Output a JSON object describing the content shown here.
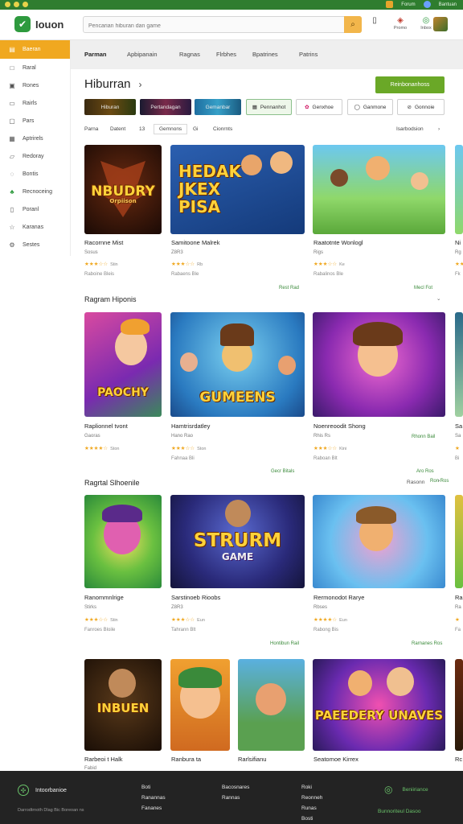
{
  "window": {
    "chrome_right": [
      "Forum",
      "Bantuan"
    ]
  },
  "header": {
    "logo": "Iouon",
    "search_placeholder": "Pencarian hiburan dan game",
    "icons": [
      {
        "icon": "bag-icon",
        "label": ""
      },
      {
        "icon": "gift-icon",
        "label": "Promo"
      },
      {
        "icon": "bell-icon",
        "label": "Inbox"
      }
    ]
  },
  "sidebar": {
    "items": [
      {
        "label": "Baeran",
        "icon": "home-icon",
        "active": true
      },
      {
        "label": "Raral",
        "icon": "square-icon"
      },
      {
        "label": "Rones",
        "icon": "grid-icon"
      },
      {
        "label": "Rairls",
        "icon": "list-icon"
      },
      {
        "label": "Pars",
        "icon": "card-icon"
      },
      {
        "label": "Aptrirels",
        "icon": "calendar-icon"
      },
      {
        "label": "Redoray",
        "icon": "chat-icon"
      },
      {
        "label": "Bontis",
        "icon": "shield-icon"
      },
      {
        "label": "Recnoceing",
        "icon": "leaf-icon"
      },
      {
        "label": "Poranl",
        "icon": "doc-icon"
      },
      {
        "label": "Karanas",
        "icon": "star-icon"
      },
      {
        "label": "Sestes",
        "icon": "gear-icon"
      }
    ]
  },
  "tabs": [
    "Parman",
    "Apbipanain",
    "Ragnas",
    "Flrbhes",
    "Bpatrines",
    "Patrins"
  ],
  "page": {
    "title": "Hiburran",
    "cta": "Reinbonanhoss"
  },
  "chips": {
    "image": [
      "Hiburan",
      "Pertandagan",
      "Gemanbar"
    ],
    "outline": [
      "Pennanhot",
      "Genxhoe",
      "Ganmone",
      "Gonnoie"
    ]
  },
  "sortrow": {
    "items": [
      "Parna",
      "Datent",
      "13",
      "Gemnons",
      "Gi",
      "Cionrnts"
    ],
    "right": "Isarbodsion"
  },
  "sections": [
    {
      "title": "",
      "link": "",
      "cards": [
        {
          "art": "NBUDRY",
          "art_sub": "Orpiison",
          "title": "Racornne Mist",
          "sub": "Sosus",
          "stars": "★★★☆☆",
          "reviews": "Stin",
          "price": "Raboine Bleis"
        },
        {
          "art": "HEDAK JKEX PISA",
          "art_sub": "",
          "title": "Samitoone Malrek",
          "sub": "Z8R3",
          "stars": "★★★☆☆",
          "reviews": "Rb",
          "price": "Rabaens Ble"
        },
        {
          "art": "",
          "art_sub": "",
          "title": "Raatotnte Wonlogl",
          "sub": "Rigs",
          "stars": "★★★☆☆",
          "reviews": "Ke",
          "price": "Rabalinos Ble"
        },
        {
          "art": "",
          "art_sub": "",
          "title": "Ni",
          "sub": "Rg",
          "stars": "★★",
          "reviews": "",
          "price": "Fk"
        }
      ],
      "see_all": [
        "Rest Rad",
        "Mecl Fot"
      ]
    },
    {
      "title": "Ragram Hiponis",
      "link": "",
      "cards": [
        {
          "art": "PAOCHY",
          "art_sub": "",
          "title": "Raplionnel tvont",
          "sub": "Gaoras",
          "stars": "★★★★☆",
          "reviews": "Ston",
          "price": ""
        },
        {
          "art": "GUMEENS",
          "art_sub": "",
          "title": "Hamtrisrdatley",
          "sub": "Hano Rao",
          "stars": "★★★☆☆",
          "reviews": "Ston",
          "price": "Fahnaa Bli"
        },
        {
          "art": "",
          "art_sub": "",
          "title": "Noenreoodit Shong",
          "sub": "Rhis Rs",
          "stars": "★★★☆☆",
          "reviews": "Kini",
          "price": "Raboan Blt"
        },
        {
          "art": "",
          "art_sub": "",
          "title": "Sa",
          "sub": "Sa",
          "stars": "★",
          "reviews": "",
          "price": "Bi"
        }
      ],
      "see_all": [
        "Rhonn Bail",
        "Gecr Bitals",
        "Aro Ros",
        "Ron Ros"
      ]
    },
    {
      "title": "Ragrtal Slhoenile",
      "link": "Rasonn",
      "cards": [
        {
          "art": "",
          "art_sub": "",
          "title": "Ranommnlrige",
          "sub": "Stirks",
          "stars": "★★★☆☆",
          "reviews": "Stin",
          "price": "Fanroes Bloile"
        },
        {
          "art": "STRURM",
          "art_sub": "GAME",
          "title": "Sarstinoeb Rioobs",
          "sub": "Z8R3",
          "stars": "★★★☆☆",
          "reviews": "Eun",
          "price": "Tahrann Blt"
        },
        {
          "art": "",
          "art_sub": "",
          "title": "Rermonodot Rarye",
          "sub": "Rbses",
          "stars": "★★★★☆",
          "reviews": "Eun",
          "price": "Rabong Bis"
        },
        {
          "art": "",
          "art_sub": "",
          "title": "Ra",
          "sub": "Ra",
          "stars": "★",
          "reviews": "",
          "price": "Fa"
        }
      ],
      "see_all": [
        "Hontibun Rail",
        "Rarnanes Ros"
      ]
    },
    {
      "title": "",
      "link": "",
      "cards": [
        {
          "art": "INBUEN",
          "art_sub": "",
          "title": "Rarbeoi t Halk",
          "sub": "Fabid",
          "stars": "",
          "reviews": "",
          "price": ""
        },
        {
          "art": "",
          "art_sub": "",
          "title": "Ranbura ta",
          "sub": "",
          "stars": "",
          "reviews": "",
          "price": ""
        },
        {
          "art": "",
          "art_sub": "",
          "title": "Rarlsifianu",
          "sub": "",
          "stars": "",
          "reviews": "",
          "price": ""
        },
        {
          "art": "PAEEDERY UNAVES",
          "art_sub": "",
          "title": "Seatomoe Kirrex",
          "sub": "",
          "stars": "",
          "reviews": "",
          "price": ""
        },
        {
          "art": "",
          "art_sub": "",
          "title": "Rc",
          "sub": "",
          "stars": "",
          "reviews": "",
          "price": ""
        }
      ],
      "see_all": []
    }
  ],
  "footer": {
    "brand": "Intoorbanioe",
    "copyright": "Darrodtrnoth Dlag Bic Boreoan ns",
    "col1": [
      "Boti",
      "Ranannas",
      "Fananes"
    ],
    "col2": [
      "Bacosnares",
      "Rannas"
    ],
    "col3": [
      "Roki",
      "Reonneh",
      "Runas",
      "Bosti"
    ],
    "social": "Beniiriance",
    "contact": "Bunnoriteul Dasoo"
  }
}
